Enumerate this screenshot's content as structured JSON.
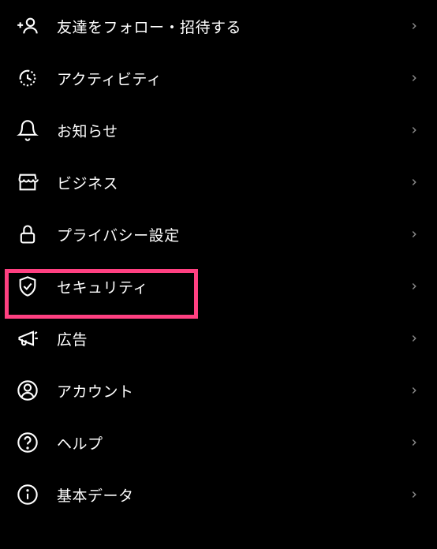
{
  "menu": {
    "items": [
      {
        "label": "友達をフォロー・招待する"
      },
      {
        "label": "アクティビティ"
      },
      {
        "label": "お知らせ"
      },
      {
        "label": "ビジネス"
      },
      {
        "label": "プライバシー設定"
      },
      {
        "label": "セキュリティ"
      },
      {
        "label": "広告"
      },
      {
        "label": "アカウント"
      },
      {
        "label": "ヘルプ"
      },
      {
        "label": "基本データ"
      }
    ]
  },
  "highlight": {
    "item_index": 5,
    "color": "#ff4081"
  }
}
